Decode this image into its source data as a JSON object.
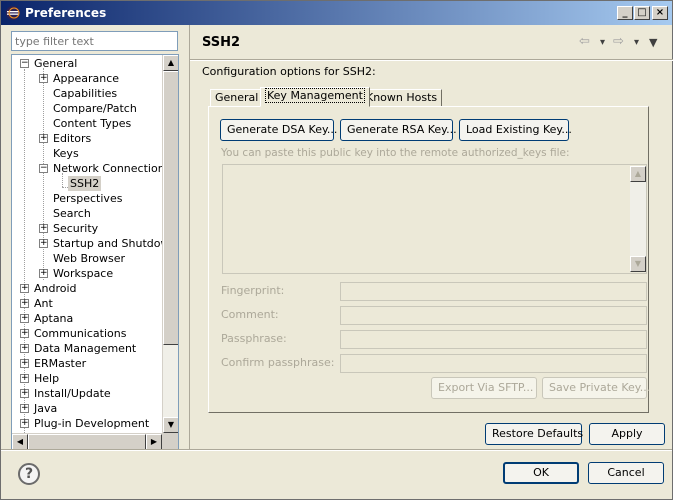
{
  "window": {
    "title": "Preferences",
    "minimize_label": "_",
    "maximize_label": "□",
    "close_label": "×"
  },
  "filter": {
    "placeholder": "type filter text"
  },
  "tree": {
    "nodes": [
      {
        "label": "General",
        "expander": "−"
      },
      {
        "label": "Appearance",
        "expander": "+"
      },
      {
        "label": "Capabilities",
        "expander": ""
      },
      {
        "label": "Compare/Patch",
        "expander": ""
      },
      {
        "label": "Content Types",
        "expander": ""
      },
      {
        "label": "Editors",
        "expander": "+"
      },
      {
        "label": "Keys",
        "expander": ""
      },
      {
        "label": "Network Connections",
        "expander": "−"
      },
      {
        "label": "SSH2",
        "expander": ""
      },
      {
        "label": "Perspectives",
        "expander": ""
      },
      {
        "label": "Search",
        "expander": ""
      },
      {
        "label": "Security",
        "expander": "+"
      },
      {
        "label": "Startup and Shutdown",
        "expander": "+"
      },
      {
        "label": "Web Browser",
        "expander": ""
      },
      {
        "label": "Workspace",
        "expander": "+"
      },
      {
        "label": "Android",
        "expander": "+"
      },
      {
        "label": "Ant",
        "expander": "+"
      },
      {
        "label": "Aptana",
        "expander": "+"
      },
      {
        "label": "Communications",
        "expander": "+"
      },
      {
        "label": "Data Management",
        "expander": "+"
      },
      {
        "label": "ERMaster",
        "expander": "+"
      },
      {
        "label": "Help",
        "expander": "+"
      },
      {
        "label": "Install/Update",
        "expander": "+"
      },
      {
        "label": "Java",
        "expander": "+"
      },
      {
        "label": "Plug-in Development",
        "expander": "+"
      }
    ],
    "scroll_up": "▲",
    "scroll_down": "▼",
    "scroll_left": "◀",
    "scroll_right": "▶"
  },
  "page": {
    "title": "SSH2",
    "description": "Configuration options for SSH2:",
    "nav_back": "⇦",
    "nav_forward": "⇨",
    "nav_back_menu": "▾",
    "nav_forward_menu": "▾",
    "view_menu": "▼"
  },
  "tabs": [
    {
      "label": "General"
    },
    {
      "label": "Key Management"
    },
    {
      "label": "Known Hosts"
    }
  ],
  "key_management": {
    "generate_dsa": "Generate DSA Key...",
    "generate_rsa": "Generate RSA Key...",
    "load_existing": "Load Existing Key...",
    "paste_hint": "You can paste this public key into the remote authorized_keys file:",
    "scroll_up": "▲",
    "scroll_down": "▼",
    "fingerprint_label": "Fingerprint:",
    "comment_label": "Comment:",
    "passphrase_label": "Passphrase:",
    "confirm_label": "Confirm passphrase:",
    "export_sftp": "Export Via SFTP...",
    "save_private": "Save Private Key..."
  },
  "page_buttons": {
    "restore_defaults": "Restore Defaults",
    "apply": "Apply"
  },
  "dialog_buttons": {
    "help": "?",
    "ok": "OK",
    "cancel": "Cancel"
  }
}
